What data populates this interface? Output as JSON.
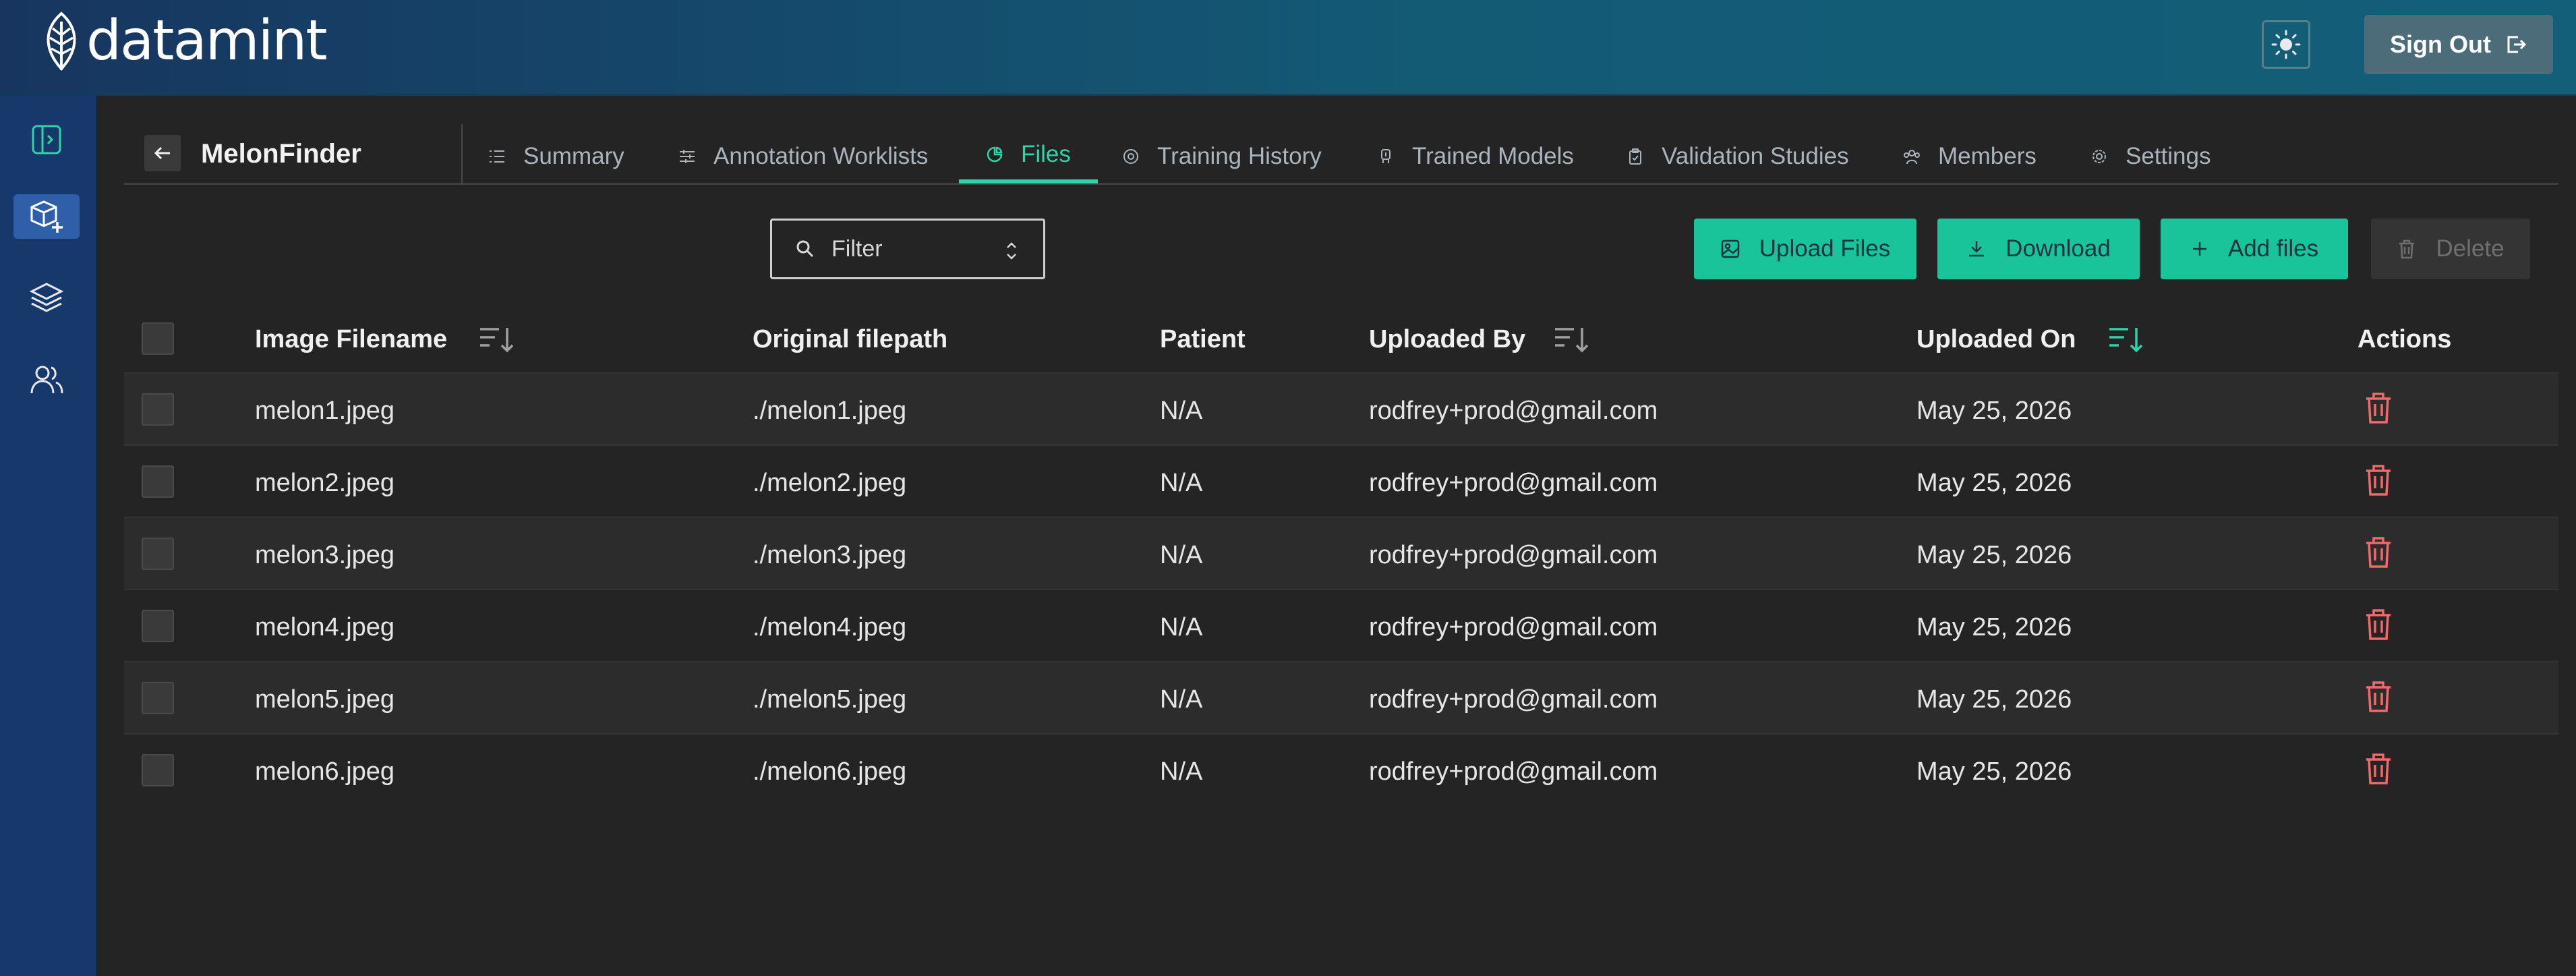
{
  "header": {
    "logo_text": "datamint",
    "sign_out_label": "Sign Out"
  },
  "sidebar": {
    "items": [
      {
        "icon": "panel-toggle-icon"
      },
      {
        "icon": "new-project-icon",
        "active": true
      },
      {
        "icon": "layers-icon"
      },
      {
        "icon": "users-icon"
      }
    ]
  },
  "project": {
    "name": "MelonFinder",
    "tabs": [
      {
        "label": "Summary",
        "icon": "list-icon"
      },
      {
        "label": "Annotation Worklists",
        "icon": "sliders-icon"
      },
      {
        "label": "Files",
        "icon": "files-icon",
        "active": true
      },
      {
        "label": "Training History",
        "icon": "training-icon"
      },
      {
        "label": "Trained Models",
        "icon": "model-icon"
      },
      {
        "label": "Validation Studies",
        "icon": "clipboard-icon"
      },
      {
        "label": "Members",
        "icon": "members-icon"
      },
      {
        "label": "Settings",
        "icon": "gear-icon"
      }
    ]
  },
  "toolbar": {
    "filter_placeholder": "Filter",
    "upload_label": "Upload Files",
    "download_label": "Download",
    "add_files_label": "Add files",
    "delete_label": "Delete"
  },
  "table": {
    "columns": [
      "Image Filename",
      "Original filepath",
      "Patient",
      "Uploaded By",
      "Uploaded On",
      "Actions"
    ],
    "rows": [
      {
        "filename": "melon1.jpeg",
        "filepath": "./melon1.jpeg",
        "patient": "N/A",
        "uploaded_by": "rodfrey+prod@gmail.com",
        "uploaded_on": "May 25, 2026"
      },
      {
        "filename": "melon2.jpeg",
        "filepath": "./melon2.jpeg",
        "patient": "N/A",
        "uploaded_by": "rodfrey+prod@gmail.com",
        "uploaded_on": "May 25, 2026"
      },
      {
        "filename": "melon3.jpeg",
        "filepath": "./melon3.jpeg",
        "patient": "N/A",
        "uploaded_by": "rodfrey+prod@gmail.com",
        "uploaded_on": "May 25, 2026"
      },
      {
        "filename": "melon4.jpeg",
        "filepath": "./melon4.jpeg",
        "patient": "N/A",
        "uploaded_by": "rodfrey+prod@gmail.com",
        "uploaded_on": "May 25, 2026"
      },
      {
        "filename": "melon5.jpeg",
        "filepath": "./melon5.jpeg",
        "patient": "N/A",
        "uploaded_by": "rodfrey+prod@gmail.com",
        "uploaded_on": "May 25, 2026"
      },
      {
        "filename": "melon6.jpeg",
        "filepath": "./melon6.jpeg",
        "patient": "N/A",
        "uploaded_by": "rodfrey+prod@gmail.com",
        "uploaded_on": "May 25, 2026"
      }
    ]
  },
  "colors": {
    "accent": "#19c49a",
    "active_tab": "#2ed3a7",
    "danger": "#f06a6a",
    "sidebar": "#16386a"
  }
}
